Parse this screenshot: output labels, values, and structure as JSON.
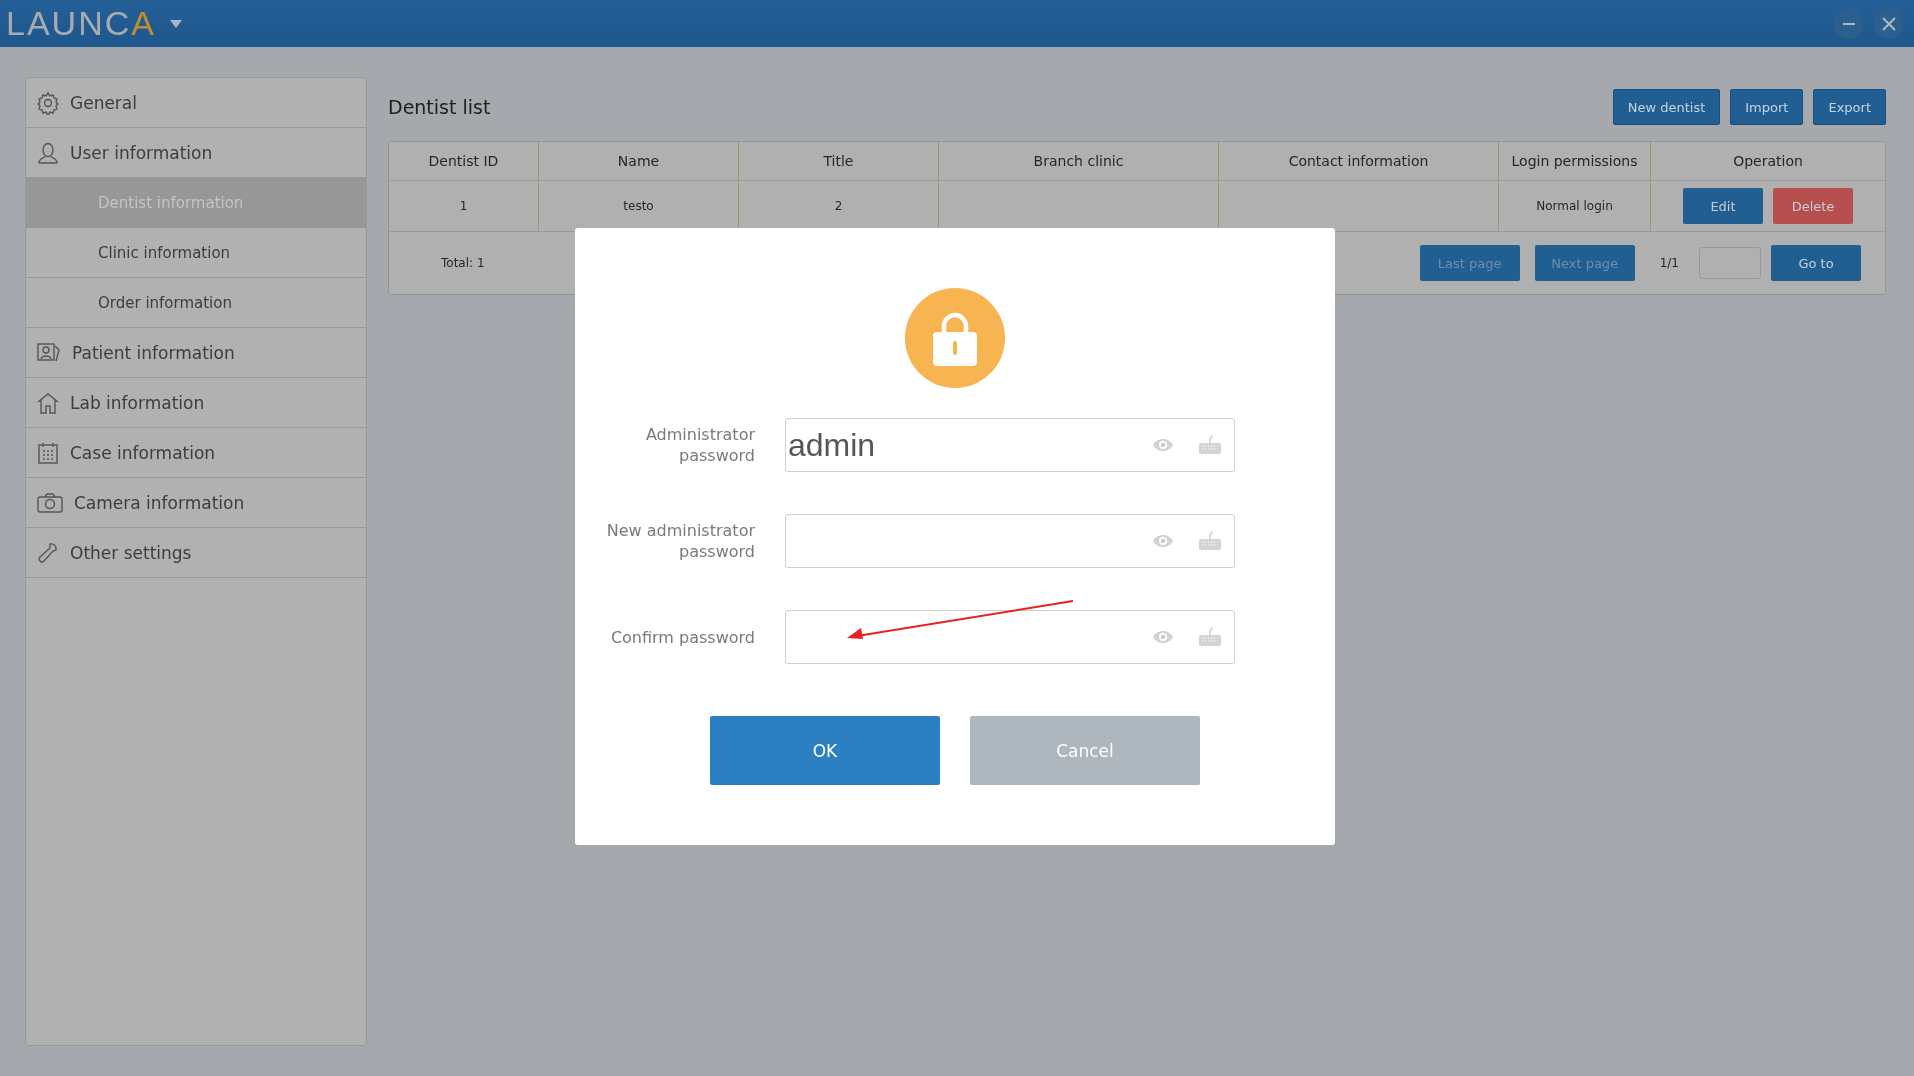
{
  "titlebar": {
    "logo": {
      "text": "LAUNC",
      "accent": "A"
    }
  },
  "sidebar": {
    "items": [
      {
        "label": "General",
        "selected": false
      },
      {
        "label": "User information",
        "selected": false,
        "expanded": true,
        "children": [
          {
            "label": "Dentist information",
            "selected": true
          },
          {
            "label": "Clinic information",
            "selected": false
          },
          {
            "label": "Order information",
            "selected": false
          }
        ]
      },
      {
        "label": "Patient information",
        "selected": false
      },
      {
        "label": "Lab information",
        "selected": false
      },
      {
        "label": "Case information",
        "selected": false
      },
      {
        "label": "Camera information",
        "selected": false
      },
      {
        "label": "Other settings",
        "selected": false
      }
    ]
  },
  "page": {
    "title": "Dentist list",
    "actions": [
      "New dentist",
      "Import",
      "Export"
    ]
  },
  "table": {
    "columns": [
      "Dentist ID",
      "Name",
      "Title",
      "Branch clinic",
      "Contact information",
      "Login permissions",
      "Operation"
    ],
    "rows": [
      {
        "cells": [
          "1",
          "testo",
          "2",
          "",
          "",
          "Normal login"
        ],
        "actions": [
          {
            "label": "Edit",
            "kind": "edit"
          },
          {
            "label": "Delete",
            "kind": "delete"
          }
        ]
      }
    ],
    "footer": {
      "total": "Total: 1",
      "pager": [
        {
          "label": "Last page",
          "disabled": true
        },
        {
          "label": "Next page",
          "disabled": true
        }
      ],
      "page": "1/1",
      "goto": "Go to"
    }
  },
  "dialog": {
    "fields": [
      {
        "label": "Administrator password",
        "value": "admin"
      },
      {
        "label": "New administrator password"
      },
      {
        "label": "Confirm password"
      }
    ],
    "buttons": [
      {
        "label": "OK",
        "kind": "primary"
      },
      {
        "label": "Cancel",
        "kind": "secondary"
      }
    ]
  }
}
